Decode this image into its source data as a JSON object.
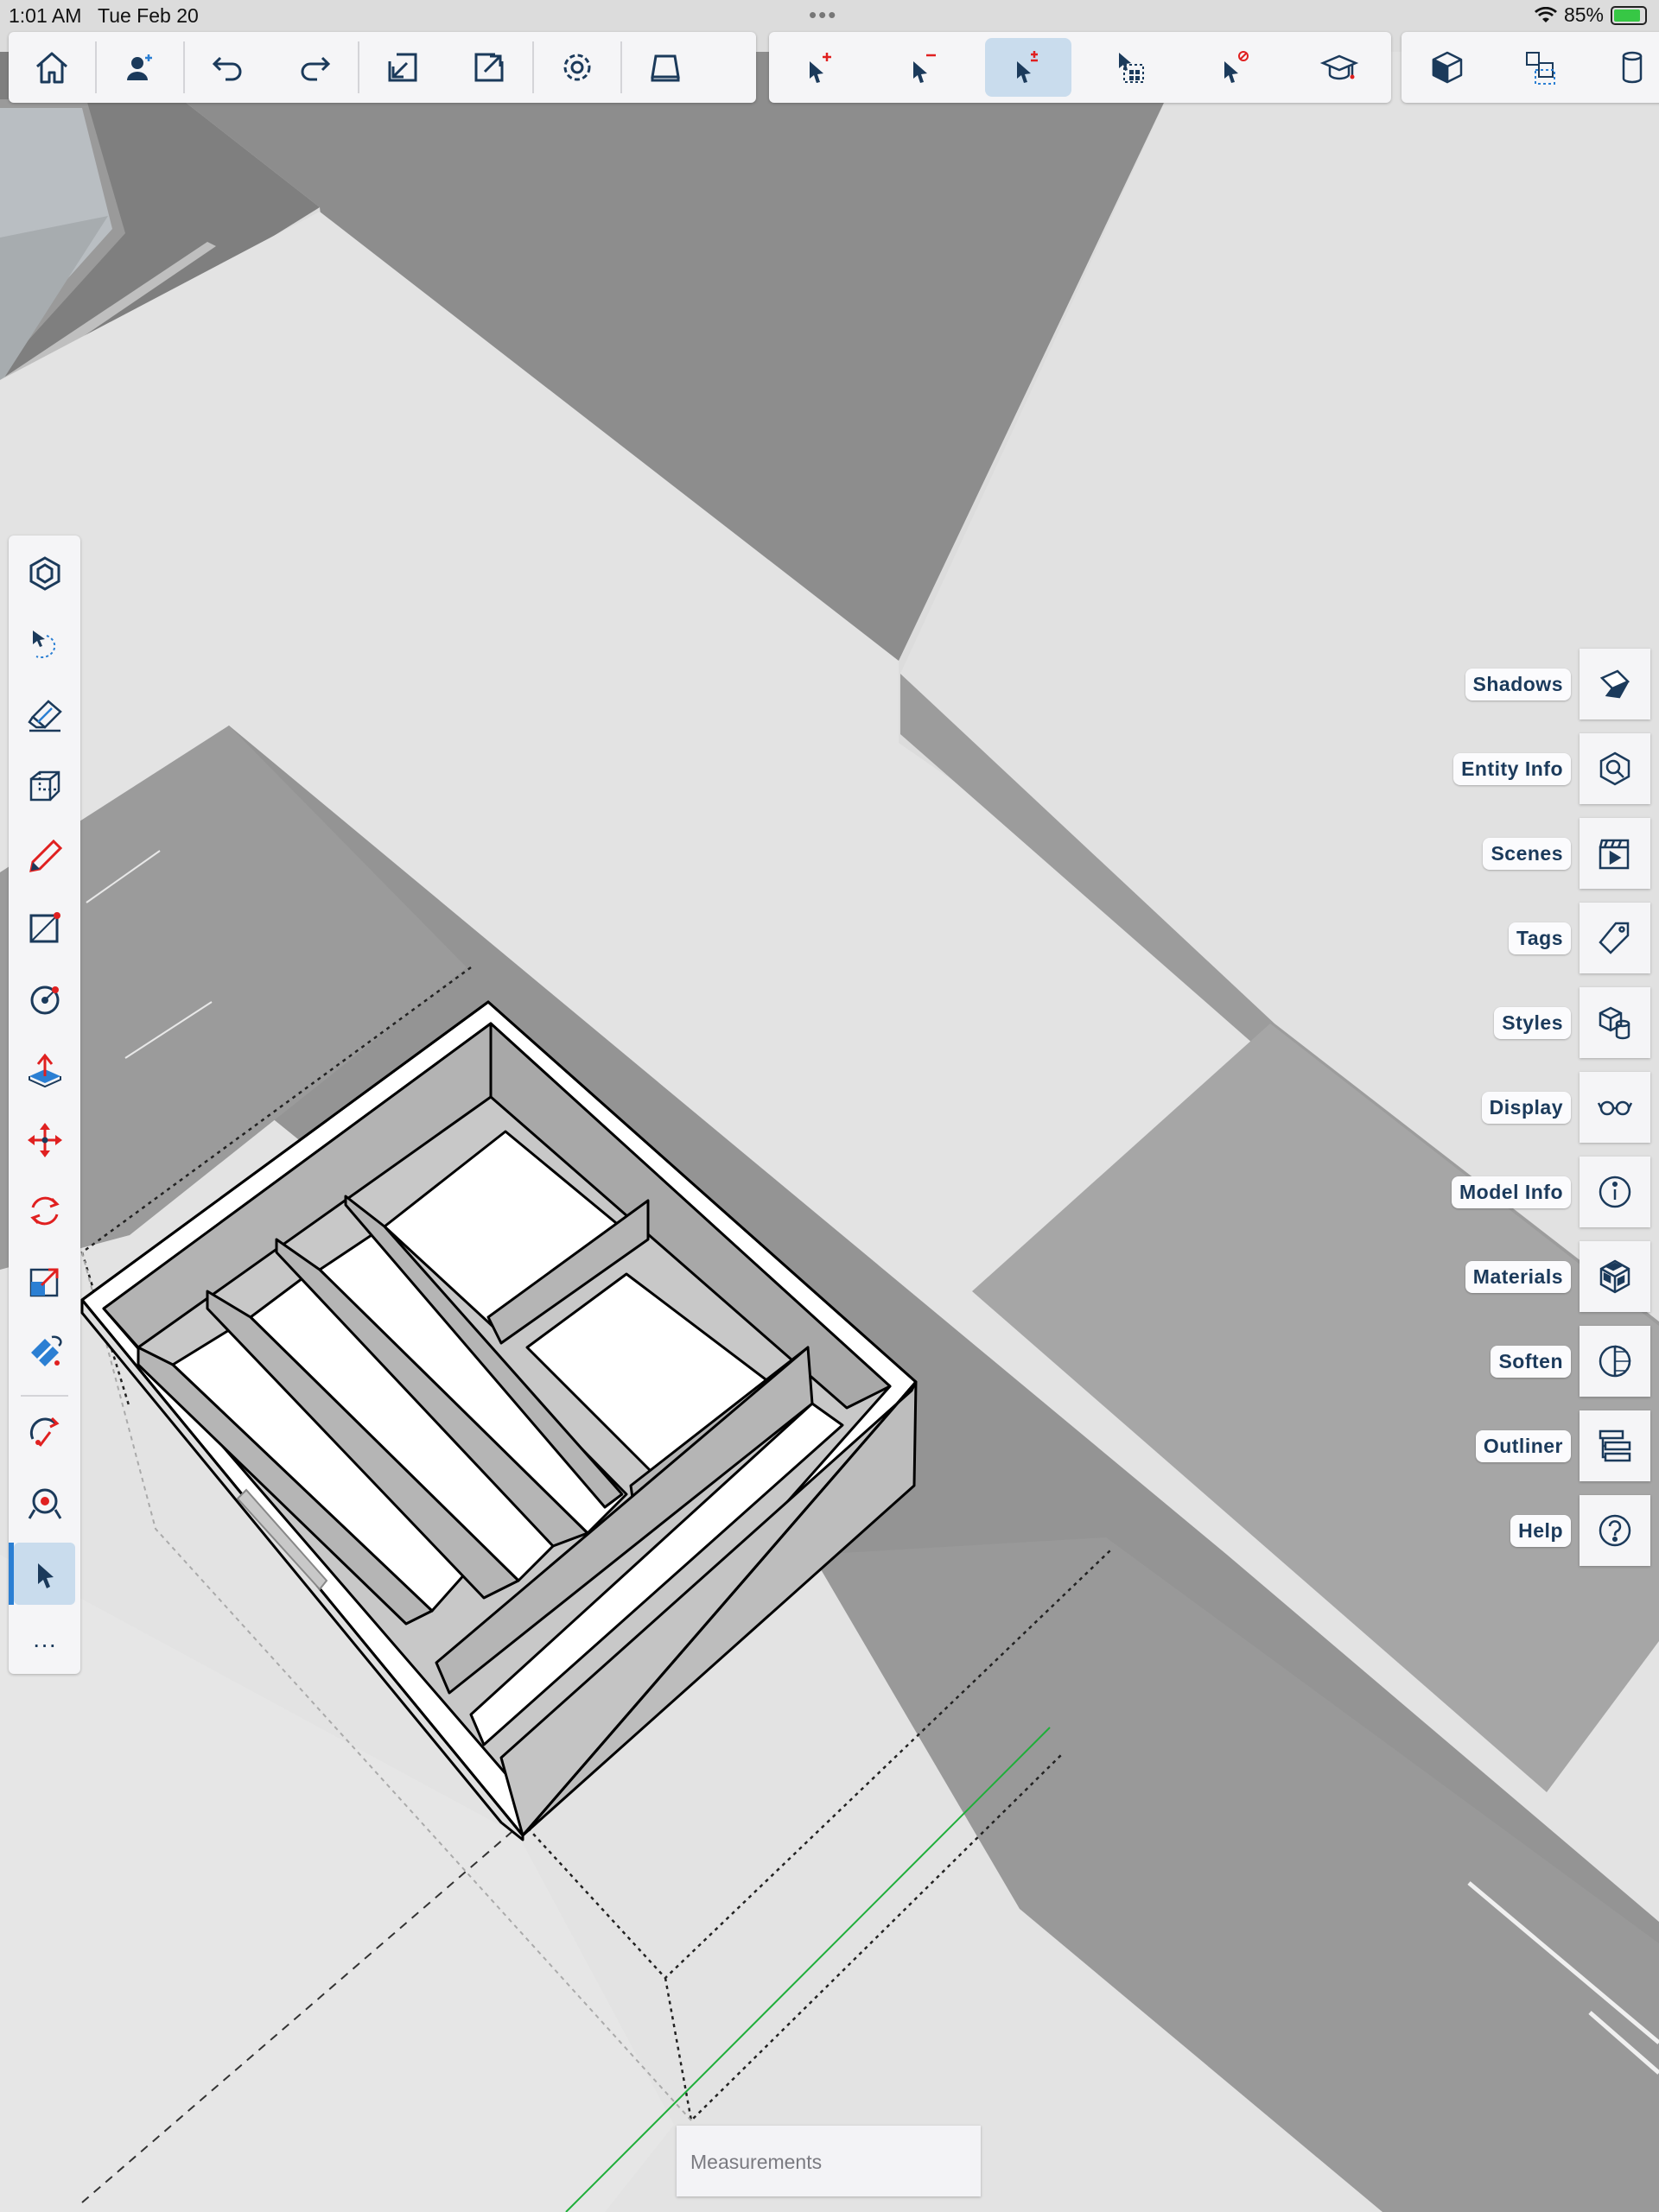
{
  "status": {
    "time": "1:01 AM",
    "date": "Tue Feb 20",
    "battery": "85%"
  },
  "top_toolbar": {
    "group1": [
      "home-icon",
      "add-user-icon",
      "undo-icon",
      "redo-icon",
      "import-icon",
      "export-icon",
      "settings-icon",
      "view-icon"
    ],
    "group2": [
      "select-add-icon",
      "select-remove-icon",
      "select-toggle-icon",
      "select-all-icon",
      "deselect-icon",
      "learn-icon"
    ],
    "group3": [
      "component-icon",
      "nested-component-icon",
      "cylinder-icon"
    ],
    "active": "select-toggle-icon"
  },
  "left_toolbar": {
    "tools": [
      "outer-shell-icon",
      "lasso-select-icon",
      "eraser-icon",
      "box-icon",
      "pencil-icon",
      "rectangle-icon",
      "circle-icon",
      "push-pull-icon",
      "move-icon",
      "rotate-icon",
      "scale-icon",
      "paint-bucket-icon",
      "orbit-icon",
      "look-around-icon",
      "select-icon",
      "more-icon"
    ],
    "active": "select-icon",
    "more_label": "···"
  },
  "right_panels": [
    {
      "label": "Shadows",
      "icon": "shadows-icon"
    },
    {
      "label": "Entity Info",
      "icon": "entity-info-icon"
    },
    {
      "label": "Scenes",
      "icon": "scenes-icon"
    },
    {
      "label": "Tags",
      "icon": "tags-icon"
    },
    {
      "label": "Styles",
      "icon": "styles-icon"
    },
    {
      "label": "Display",
      "icon": "display-icon"
    },
    {
      "label": "Model Info",
      "icon": "model-info-icon"
    },
    {
      "label": "Materials",
      "icon": "materials-icon"
    },
    {
      "label": "Soften",
      "icon": "soften-icon"
    },
    {
      "label": "Outliner",
      "icon": "outliner-icon"
    },
    {
      "label": "Help",
      "icon": "help-icon"
    }
  ],
  "measurements": {
    "placeholder": "Measurements"
  },
  "colors": {
    "icon": "#1b3a5b",
    "accent_red": "#e02020",
    "active_bg": "#c9dced",
    "axis_green": "#1fae3a"
  }
}
